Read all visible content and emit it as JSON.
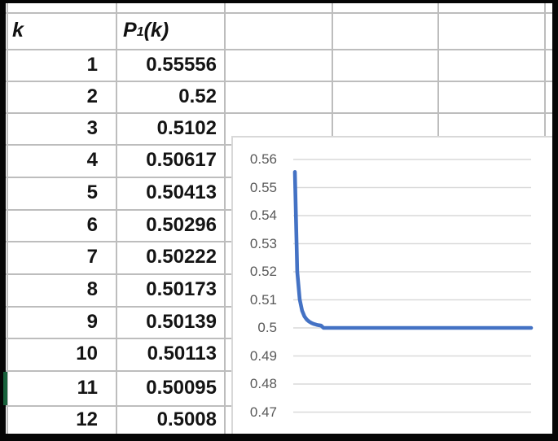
{
  "table": {
    "header": {
      "k_label": "k",
      "p_base": "P",
      "p_sub": "1",
      "p_paren_open": "(",
      "p_arg": "k",
      "p_paren_close": ")"
    },
    "rows": [
      {
        "k": "1",
        "v": "0.55556"
      },
      {
        "k": "2",
        "v": "0.52"
      },
      {
        "k": "3",
        "v": "0.5102"
      },
      {
        "k": "4",
        "v": "0.50617"
      },
      {
        "k": "5",
        "v": "0.50413"
      },
      {
        "k": "6",
        "v": "0.50296"
      },
      {
        "k": "7",
        "v": "0.50222"
      },
      {
        "k": "8",
        "v": "0.50173"
      },
      {
        "k": "9",
        "v": "0.50139"
      },
      {
        "k": "10",
        "v": "0.50113"
      },
      {
        "k": "11",
        "v": "0.50095"
      },
      {
        "k": "12",
        "v": "0.5008"
      }
    ]
  },
  "chart_data": {
    "type": "line",
    "title": "",
    "xlabel": "",
    "ylabel": "",
    "x": [
      1,
      2,
      3,
      4,
      5,
      6,
      7,
      8,
      9,
      10,
      11,
      12
    ],
    "values": [
      0.55556,
      0.52,
      0.5102,
      0.50617,
      0.50413,
      0.50296,
      0.50222,
      0.50173,
      0.50139,
      0.50113,
      0.50095,
      0.5008
    ],
    "x_extends_to": 100,
    "asymptote": 0.5,
    "ylim": [
      0.47,
      0.56
    ],
    "y_ticks": [
      "0.56",
      "0.55",
      "0.54",
      "0.53",
      "0.52",
      "0.51",
      "0.5",
      "0.49",
      "0.48",
      "0.47"
    ],
    "grid": true,
    "legend": false,
    "line_color": "#4472C4",
    "gridline_color": "#d9d9d9",
    "tick_color": "#595959"
  },
  "colors": {
    "frame": "#060606",
    "sheet_gridline": "#bdbdbd",
    "selection_green": "#17613b",
    "chart_border": "#d8d8d8"
  }
}
